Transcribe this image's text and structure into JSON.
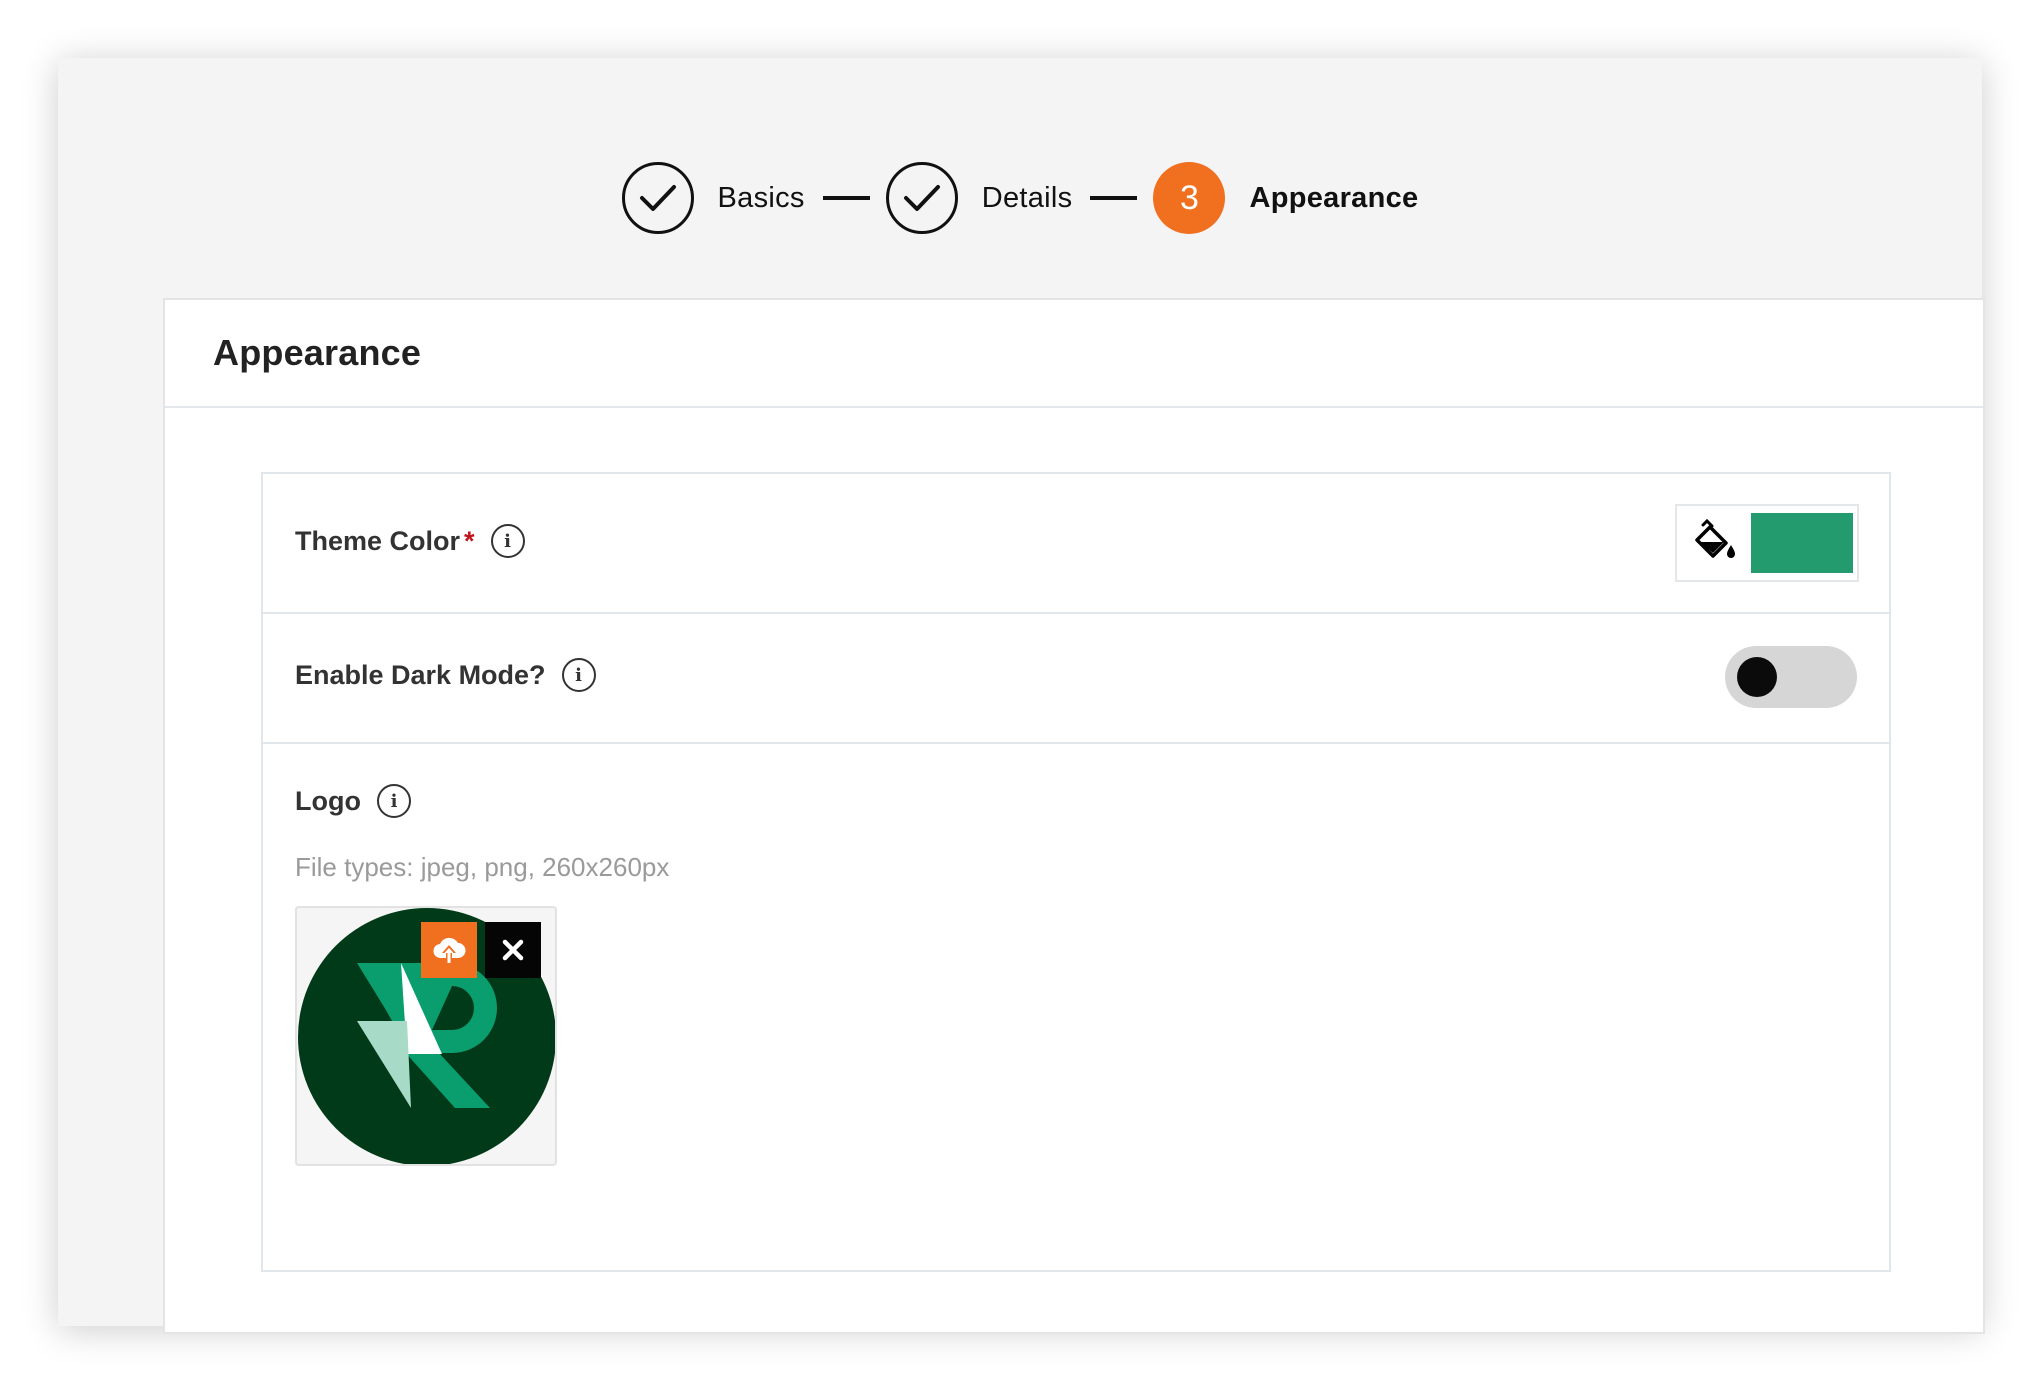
{
  "stepper": {
    "steps": [
      {
        "label": "Basics",
        "state": "complete",
        "icon": "check-icon"
      },
      {
        "label": "Details",
        "state": "complete",
        "icon": "check-icon"
      },
      {
        "label": "Appearance",
        "state": "active",
        "number": "3"
      }
    ]
  },
  "card": {
    "title": "Appearance"
  },
  "theme_color": {
    "label": "Theme Color",
    "required_mark": "*",
    "info_icon": "i",
    "value": "#239b6e",
    "icon": "paint-bucket-icon"
  },
  "dark_mode": {
    "label": "Enable Dark Mode?",
    "info_icon": "i",
    "enabled": false
  },
  "logo": {
    "label": "Logo",
    "info_icon": "i",
    "hint": "File types: jpeg, png, 260x260px",
    "upload_icon": "cloud-upload-icon",
    "remove_icon": "close-icon"
  },
  "colors": {
    "accent": "#f07020",
    "logo_background": "#003a18",
    "logo_green": "#0a9e6e",
    "logo_light": "#a7dbc7"
  }
}
